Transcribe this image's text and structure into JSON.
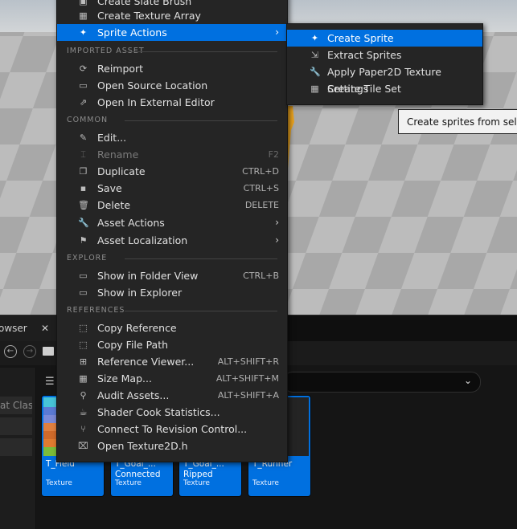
{
  "context_menu": {
    "top_items": [
      {
        "label": "Create Slate Brush",
        "icon": "brush-icon"
      },
      {
        "label": "Create Texture Array",
        "icon": "texture-array-icon"
      },
      {
        "label": "Sprite Actions",
        "icon": "sprite-icon",
        "has_submenu": true,
        "highlighted": true
      }
    ],
    "sections": {
      "imported_asset": "IMPORTED ASSET",
      "common": "COMMON",
      "explore": "EXPLORE",
      "references": "REFERENCES"
    },
    "imported_asset_items": [
      {
        "label": "Reimport",
        "icon": "reimport-icon"
      },
      {
        "label": "Open Source Location",
        "icon": "folder-open-icon"
      },
      {
        "label": "Open In External Editor",
        "icon": "external-editor-icon"
      }
    ],
    "common_items": [
      {
        "label": "Edit...",
        "icon": "pencil-icon",
        "shortcut": ""
      },
      {
        "label": "Rename",
        "icon": "rename-icon",
        "shortcut": "F2",
        "disabled": true
      },
      {
        "label": "Duplicate",
        "icon": "duplicate-icon",
        "shortcut": "CTRL+D"
      },
      {
        "label": "Save",
        "icon": "save-icon",
        "shortcut": "CTRL+S"
      },
      {
        "label": "Delete",
        "icon": "trash-icon",
        "shortcut": "DELETE"
      },
      {
        "label": "Asset Actions",
        "icon": "wrench-icon",
        "has_submenu": true
      },
      {
        "label": "Asset Localization",
        "icon": "flag-icon",
        "has_submenu": true
      }
    ],
    "explore_items": [
      {
        "label": "Show in Folder View",
        "icon": "folder-search-icon",
        "shortcut": "CTRL+B"
      },
      {
        "label": "Show in Explorer",
        "icon": "explorer-icon",
        "shortcut": ""
      }
    ],
    "references_items": [
      {
        "label": "Copy Reference",
        "icon": "copy-reference-icon",
        "shortcut": ""
      },
      {
        "label": "Copy File Path",
        "icon": "copy-path-icon",
        "shortcut": ""
      },
      {
        "label": "Reference Viewer...",
        "icon": "reference-viewer-icon",
        "shortcut": "ALT+SHIFT+R"
      },
      {
        "label": "Size Map...",
        "icon": "size-map-icon",
        "shortcut": "ALT+SHIFT+M"
      },
      {
        "label": "Audit Assets...",
        "icon": "audit-icon",
        "shortcut": "ALT+SHIFT+A"
      },
      {
        "label": "Shader Cook Statistics...",
        "icon": "shader-stats-icon",
        "shortcut": ""
      },
      {
        "label": "Connect To Revision Control...",
        "icon": "revision-control-icon",
        "shortcut": ""
      },
      {
        "label": "Open Texture2D.h",
        "icon": "header-file-icon",
        "shortcut": ""
      }
    ]
  },
  "sprite_submenu": {
    "items": [
      {
        "label": "Create Sprite",
        "icon": "create-sprite-icon",
        "highlighted": true
      },
      {
        "label": "Extract Sprites",
        "icon": "extract-sprites-icon"
      },
      {
        "label": "Apply Paper2D Texture Settings",
        "icon": "paper2d-settings-icon"
      },
      {
        "label": "Create Tile Set",
        "icon": "tile-set-icon"
      }
    ]
  },
  "tooltip": {
    "text": "Create sprites from selecte"
  },
  "content_browser": {
    "tab_label": "owser",
    "left_rows": [
      "at Clas",
      "",
      ""
    ],
    "assets": [
      {
        "name": "T_Field",
        "subtitle": "",
        "type": "Texture"
      },
      {
        "name": "T_Goal_...",
        "subtitle": "Connected",
        "type": "Texture"
      },
      {
        "name": "T_Goal_...",
        "subtitle": "Ripped",
        "type": "Texture"
      },
      {
        "name": "T_Runner",
        "subtitle": "",
        "type": "Texture"
      }
    ]
  },
  "colors": {
    "accent": "#0070e0",
    "menu_bg": "#252525",
    "tile_bg": "#0070e0"
  }
}
